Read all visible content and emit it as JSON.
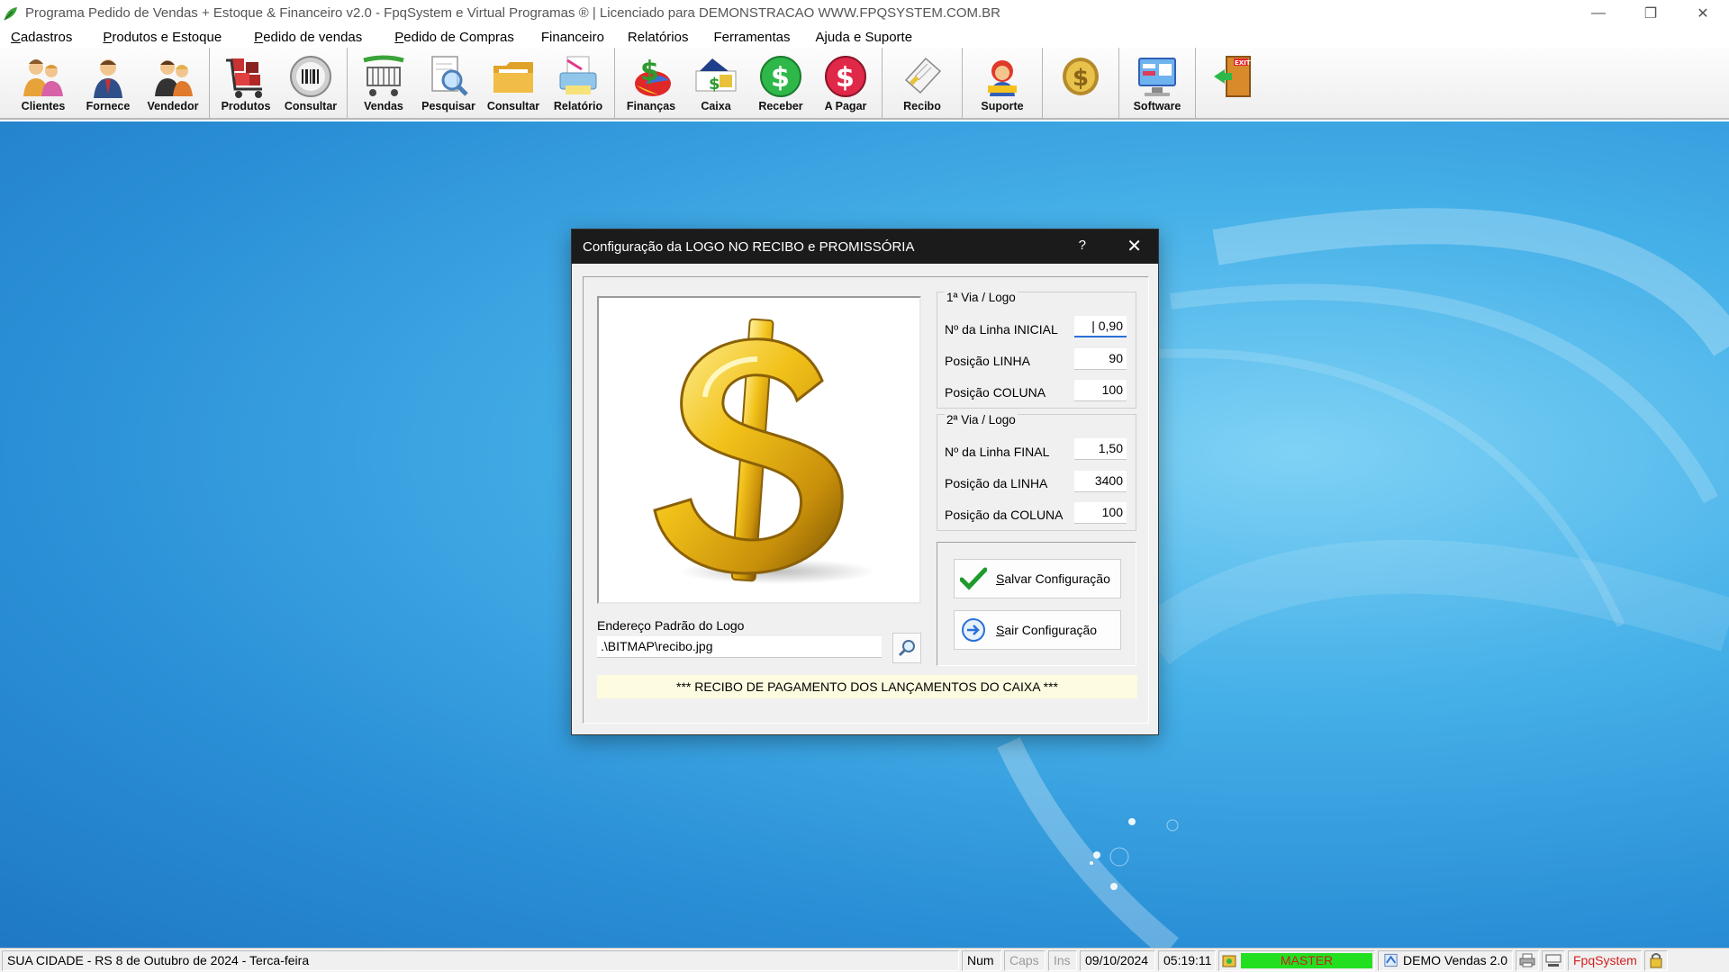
{
  "window": {
    "title": "Programa Pedido de Vendas + Estoque & Financeiro v2.0 - FpqSystem e Virtual Programas ® | Licenciado para  DEMONSTRACAO WWW.FPQSYSTEM.COM.BR"
  },
  "menu": [
    {
      "u": "C",
      "rest": "adastros"
    },
    {
      "u": "P",
      "rest": "rodutos e Estoque"
    },
    {
      "u": "P",
      "rest": "edido de vendas"
    },
    {
      "u": "P",
      "rest": "edido de Compras"
    },
    {
      "u": "",
      "rest": "Financeiro"
    },
    {
      "u": "",
      "rest": "Relatórios"
    },
    {
      "u": "",
      "rest": "Ferramentas"
    },
    {
      "u": "",
      "rest": "Ajuda e Suporte"
    }
  ],
  "toolbar": {
    "clientes": "Clientes",
    "fornece": "Fornece",
    "vendedor": "Vendedor",
    "produtos": "Produtos",
    "consultar1": "Consultar",
    "vendas": "Vendas",
    "pesquisar": "Pesquisar",
    "consultar2": "Consultar",
    "relatorio": "Relatório",
    "financas": "Finanças",
    "caixa": "Caixa",
    "receber": "Receber",
    "apagar": "A Pagar",
    "recibo": "Recibo",
    "suporte": "Suporte",
    "software": "Software",
    "exit_text": "EXIT"
  },
  "dialog": {
    "title": "Configuração da LOGO NO RECIBO e PROMISSÓRIA",
    "help": "?",
    "group1": {
      "label": "1ª Via / Logo",
      "f1_label": "Nº da Linha INICIAL",
      "f1_value": "0,90",
      "f2_label": "Posição LINHA",
      "f2_value": "90",
      "f3_label": "Posição COLUNA",
      "f3_value": "100"
    },
    "group2": {
      "label": "2ª Via / Logo",
      "f1_label": "Nº da Linha FINAL",
      "f1_value": "1,50",
      "f2_label": "Posição da LINHA",
      "f2_value": "3400",
      "f3_label": "Posição da COLUNA",
      "f3_value": "100"
    },
    "save_u": "S",
    "save_rest": "alvar Configuração",
    "exit_u": "S",
    "exit_rest": "air Configuração",
    "path_label": "Endereço Padrão do Logo",
    "path_value": ".\\BITMAP\\recibo.jpg",
    "banner": "*** RECIBO DE PAGAMENTO DOS LANÇAMENTOS DO CAIXA ***"
  },
  "status": {
    "location": "SUA CIDADE - RS  8 de Outubro de 2024 - Terca-feira",
    "num": "Num",
    "caps": "Caps",
    "ins": "Ins",
    "date": "09/10/2024",
    "time": "05:19:11",
    "user": "MASTER",
    "version": "DEMO Vendas 2.0",
    "brand": "FpqSystem"
  },
  "colors": {
    "title_bar_dialog": "#1b1b1b",
    "status_user_bg": "#22e01f",
    "status_user_fg": "#c62020",
    "brand_red": "#d42020",
    "desktop_blue": "#2a8fd6"
  }
}
